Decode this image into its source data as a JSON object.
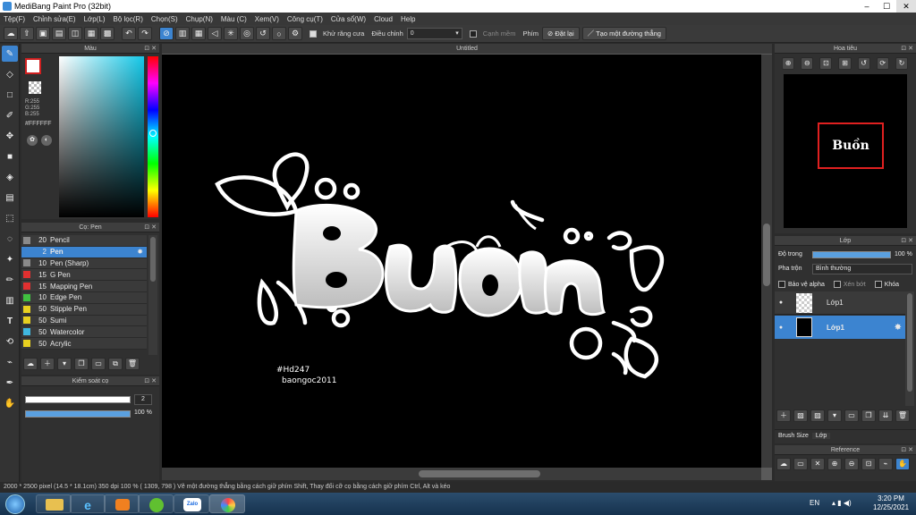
{
  "window": {
    "title": "MediBang Paint Pro (32bit)",
    "min": "–",
    "max": "☐",
    "close": "✕"
  },
  "menu": [
    "Tệp(F)",
    "Chỉnh sửa(E)",
    "Lớp(L)",
    "Bộ lọc(R)",
    "Chọn(S)",
    "Chụp(N)",
    "Màu (C)",
    "Xem(V)",
    "Công cụ(T)",
    "Cửa sổ(W)",
    "Cloud",
    "Help"
  ],
  "toolbar": {
    "antialias_label": "Khử răng cưa",
    "correction_label": "Điều chỉnh",
    "correction_value": "0",
    "edge_label": "Cạnh mềm",
    "keys_label": "Phím",
    "reset_label": "Đặt lại",
    "line_label": "Tạo một đường thẳng"
  },
  "color_panel": {
    "title": "Màu",
    "r": "R:255",
    "g": "G:255",
    "b": "B:255",
    "hex": "#FFFFFF"
  },
  "brush_panel": {
    "title": "Cọ: Pen",
    "items": [
      {
        "size": "20",
        "name": "Pencil",
        "color": "#8a8a8a"
      },
      {
        "size": "2",
        "name": "Pen",
        "color": "#3c84d0"
      },
      {
        "size": "10",
        "name": "Pen (Sharp)",
        "color": "#8a8a8a"
      },
      {
        "size": "15",
        "name": "G Pen",
        "color": "#e03030"
      },
      {
        "size": "15",
        "name": "Mapping Pen",
        "color": "#e03030"
      },
      {
        "size": "10",
        "name": "Edge Pen",
        "color": "#40c040"
      },
      {
        "size": "50",
        "name": "Stipple Pen",
        "color": "#e8d020"
      },
      {
        "size": "50",
        "name": "Sumi",
        "color": "#e8d020"
      },
      {
        "size": "50",
        "name": "Watercolor",
        "color": "#40b8e0"
      },
      {
        "size": "50",
        "name": "Acrylic",
        "color": "#e8d020"
      }
    ]
  },
  "control_panel": {
    "title": "Kiểm soát cọ",
    "size_value": "2",
    "opacity_value": "100 %",
    "opacity_fraction": 1.0
  },
  "canvas": {
    "tab": "Untitled",
    "art_text": "Buồn",
    "signature1": "#Hd247",
    "signature2": "baongoc2011"
  },
  "navigator": {
    "title": "Hoa tiêu",
    "thumb_text": "Buồn"
  },
  "layer_panel": {
    "title": "Lớp",
    "opacity_label": "Độ trong",
    "opacity_value": "100 %",
    "blend_label": "Pha trộn",
    "blend_value": "Bình thường",
    "protect_alpha": "Bảo vệ alpha",
    "clipping": "Xén bớt",
    "lock": "Khóa",
    "layers": [
      {
        "name": "Lớp1"
      },
      {
        "name": "Lớp1"
      }
    ],
    "tab_brush_size": "Brush Size",
    "tab_layer": "Lớp"
  },
  "reference_panel": {
    "title": "Reference"
  },
  "status": {
    "text": "2000 * 2500 pixel   (14.5 * 18.1cm)   350 dpi   100 %   ( 1309, 798 )   Vẽ một đường thẳng bằng cách giữ phím Shift, Thay đổi cỡ cọ bằng cách giữ phím Ctrl, Alt và kéo"
  },
  "taskbar": {
    "lang": "EN",
    "time": "3:20 PM",
    "date": "12/25/2021",
    "zalo": "Zalo"
  },
  "colors": {
    "accent": "#3c84d0",
    "panel": "#303030",
    "canvas": "#000000"
  }
}
